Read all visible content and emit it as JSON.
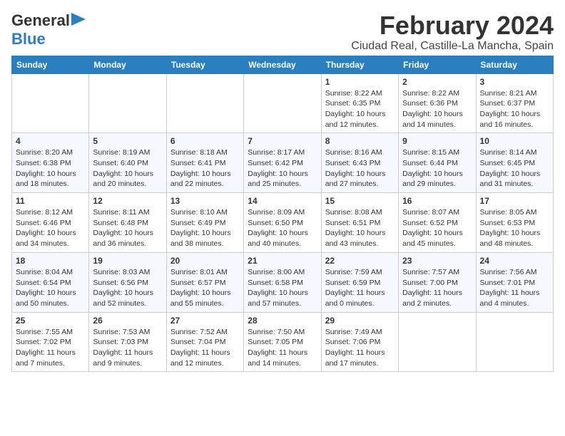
{
  "header": {
    "logo_line1": "General",
    "logo_line2": "Blue",
    "title": "February 2024",
    "subtitle": "Ciudad Real, Castille-La Mancha, Spain"
  },
  "days_of_week": [
    "Sunday",
    "Monday",
    "Tuesday",
    "Wednesday",
    "Thursday",
    "Friday",
    "Saturday"
  ],
  "weeks": [
    [
      {
        "day": "",
        "info": ""
      },
      {
        "day": "",
        "info": ""
      },
      {
        "day": "",
        "info": ""
      },
      {
        "day": "",
        "info": ""
      },
      {
        "day": "1",
        "info": "Sunrise: 8:22 AM\nSunset: 6:35 PM\nDaylight: 10 hours\nand 12 minutes."
      },
      {
        "day": "2",
        "info": "Sunrise: 8:22 AM\nSunset: 6:36 PM\nDaylight: 10 hours\nand 14 minutes."
      },
      {
        "day": "3",
        "info": "Sunrise: 8:21 AM\nSunset: 6:37 PM\nDaylight: 10 hours\nand 16 minutes."
      }
    ],
    [
      {
        "day": "4",
        "info": "Sunrise: 8:20 AM\nSunset: 6:38 PM\nDaylight: 10 hours\nand 18 minutes."
      },
      {
        "day": "5",
        "info": "Sunrise: 8:19 AM\nSunset: 6:40 PM\nDaylight: 10 hours\nand 20 minutes."
      },
      {
        "day": "6",
        "info": "Sunrise: 8:18 AM\nSunset: 6:41 PM\nDaylight: 10 hours\nand 22 minutes."
      },
      {
        "day": "7",
        "info": "Sunrise: 8:17 AM\nSunset: 6:42 PM\nDaylight: 10 hours\nand 25 minutes."
      },
      {
        "day": "8",
        "info": "Sunrise: 8:16 AM\nSunset: 6:43 PM\nDaylight: 10 hours\nand 27 minutes."
      },
      {
        "day": "9",
        "info": "Sunrise: 8:15 AM\nSunset: 6:44 PM\nDaylight: 10 hours\nand 29 minutes."
      },
      {
        "day": "10",
        "info": "Sunrise: 8:14 AM\nSunset: 6:45 PM\nDaylight: 10 hours\nand 31 minutes."
      }
    ],
    [
      {
        "day": "11",
        "info": "Sunrise: 8:12 AM\nSunset: 6:46 PM\nDaylight: 10 hours\nand 34 minutes."
      },
      {
        "day": "12",
        "info": "Sunrise: 8:11 AM\nSunset: 6:48 PM\nDaylight: 10 hours\nand 36 minutes."
      },
      {
        "day": "13",
        "info": "Sunrise: 8:10 AM\nSunset: 6:49 PM\nDaylight: 10 hours\nand 38 minutes."
      },
      {
        "day": "14",
        "info": "Sunrise: 8:09 AM\nSunset: 6:50 PM\nDaylight: 10 hours\nand 40 minutes."
      },
      {
        "day": "15",
        "info": "Sunrise: 8:08 AM\nSunset: 6:51 PM\nDaylight: 10 hours\nand 43 minutes."
      },
      {
        "day": "16",
        "info": "Sunrise: 8:07 AM\nSunset: 6:52 PM\nDaylight: 10 hours\nand 45 minutes."
      },
      {
        "day": "17",
        "info": "Sunrise: 8:05 AM\nSunset: 6:53 PM\nDaylight: 10 hours\nand 48 minutes."
      }
    ],
    [
      {
        "day": "18",
        "info": "Sunrise: 8:04 AM\nSunset: 6:54 PM\nDaylight: 10 hours\nand 50 minutes."
      },
      {
        "day": "19",
        "info": "Sunrise: 8:03 AM\nSunset: 6:56 PM\nDaylight: 10 hours\nand 52 minutes."
      },
      {
        "day": "20",
        "info": "Sunrise: 8:01 AM\nSunset: 6:57 PM\nDaylight: 10 hours\nand 55 minutes."
      },
      {
        "day": "21",
        "info": "Sunrise: 8:00 AM\nSunset: 6:58 PM\nDaylight: 10 hours\nand 57 minutes."
      },
      {
        "day": "22",
        "info": "Sunrise: 7:59 AM\nSunset: 6:59 PM\nDaylight: 11 hours\nand 0 minutes."
      },
      {
        "day": "23",
        "info": "Sunrise: 7:57 AM\nSunset: 7:00 PM\nDaylight: 11 hours\nand 2 minutes."
      },
      {
        "day": "24",
        "info": "Sunrise: 7:56 AM\nSunset: 7:01 PM\nDaylight: 11 hours\nand 4 minutes."
      }
    ],
    [
      {
        "day": "25",
        "info": "Sunrise: 7:55 AM\nSunset: 7:02 PM\nDaylight: 11 hours\nand 7 minutes."
      },
      {
        "day": "26",
        "info": "Sunrise: 7:53 AM\nSunset: 7:03 PM\nDaylight: 11 hours\nand 9 minutes."
      },
      {
        "day": "27",
        "info": "Sunrise: 7:52 AM\nSunset: 7:04 PM\nDaylight: 11 hours\nand 12 minutes."
      },
      {
        "day": "28",
        "info": "Sunrise: 7:50 AM\nSunset: 7:05 PM\nDaylight: 11 hours\nand 14 minutes."
      },
      {
        "day": "29",
        "info": "Sunrise: 7:49 AM\nSunset: 7:06 PM\nDaylight: 11 hours\nand 17 minutes."
      },
      {
        "day": "",
        "info": ""
      },
      {
        "day": "",
        "info": ""
      }
    ]
  ]
}
